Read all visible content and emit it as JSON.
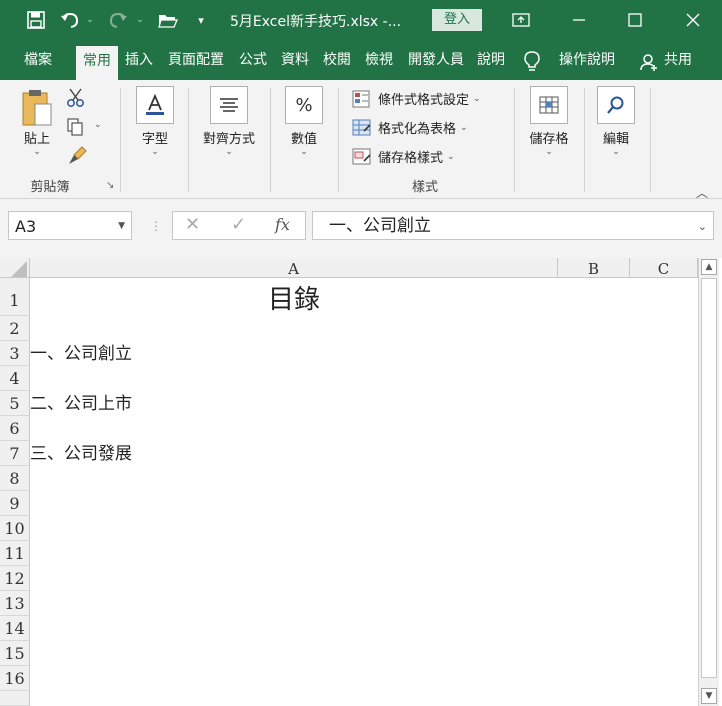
{
  "window": {
    "title": "5月Excel新手技巧.xlsx  -...",
    "signin_label": "登入",
    "icons": [
      "save-icon",
      "undo-icon",
      "redo-icon",
      "open-folder-icon",
      "customize-qat-icon",
      "ribbon-display-icon",
      "minimize-icon",
      "maximize-icon",
      "close-icon"
    ]
  },
  "tabs": [
    {
      "label": "檔案"
    },
    {
      "label": "常用"
    },
    {
      "label": "插入"
    },
    {
      "label": "頁面配置"
    },
    {
      "label": "公式"
    },
    {
      "label": "資料"
    },
    {
      "label": "校閱"
    },
    {
      "label": "檢視"
    },
    {
      "label": "開發人員"
    },
    {
      "label": "說明"
    }
  ],
  "tellme_label": "操作說明",
  "share_label": "共用",
  "ribbon": {
    "clipboard": {
      "paste_label": "貼上",
      "group_label": "剪貼簿"
    },
    "font_label": "字型",
    "align_label": "對齊方式",
    "number_label": "數值",
    "styles": {
      "conditional": "條件式格式設定",
      "table": "格式化為表格",
      "cell_styles": "儲存格樣式",
      "group_label": "樣式"
    },
    "cells_label": "儲存格",
    "editing_label": "編輯"
  },
  "formula_bar": {
    "name_box": "A3",
    "fx": "fx",
    "content": "一、公司創立"
  },
  "sheet": {
    "columns": [
      "A",
      "B",
      "C"
    ],
    "rows": [
      "1",
      "2",
      "3",
      "4",
      "5",
      "6",
      "7",
      "8",
      "9",
      "10",
      "11",
      "12",
      "13",
      "14",
      "15",
      "16"
    ],
    "cells": {
      "A1": "目錄",
      "A3": "一、公司創立",
      "A5": "二、公司上市",
      "A7": "三、公司發展"
    }
  },
  "colors": {
    "brand": "#217346",
    "ribbon_bg": "#f3f3f3"
  }
}
